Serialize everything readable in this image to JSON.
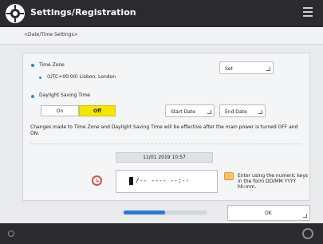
{
  "app": {
    "title": "Settings/Registration",
    "breadcrumb": "<Date/Time Settings>"
  },
  "timezone": {
    "label": "Time Zone",
    "value": "(UTC+00:00) Lisbon, London",
    "set_button": "Set"
  },
  "dst": {
    "label": "Daylight Saving Time",
    "on_label": "On",
    "off_label": "Off",
    "start_button": "Start Date",
    "end_button": "End Date",
    "selected": "Off"
  },
  "note": "Changes made to Time Zone and Daylight Saving Time will be effective after the main power is turned OFF and ON.",
  "datetime_current": "11/01 2019 10:57",
  "entry": {
    "mask": "/-- ---- --:--",
    "help": "Enter using the numeric keys in the form DD/MM YYYY hh:mm."
  },
  "footer": {
    "ok_label": "OK",
    "progress_fraction": 0.5
  },
  "colors": {
    "accent_yellow": "#f7e600",
    "accent_blue": "#2a7bd7",
    "topbar": "#2b2b2f"
  },
  "icons": {
    "app": "settings-icon",
    "menu": "menu-icon",
    "clock": "clock-icon",
    "keyboard": "numeric-keys-icon"
  }
}
